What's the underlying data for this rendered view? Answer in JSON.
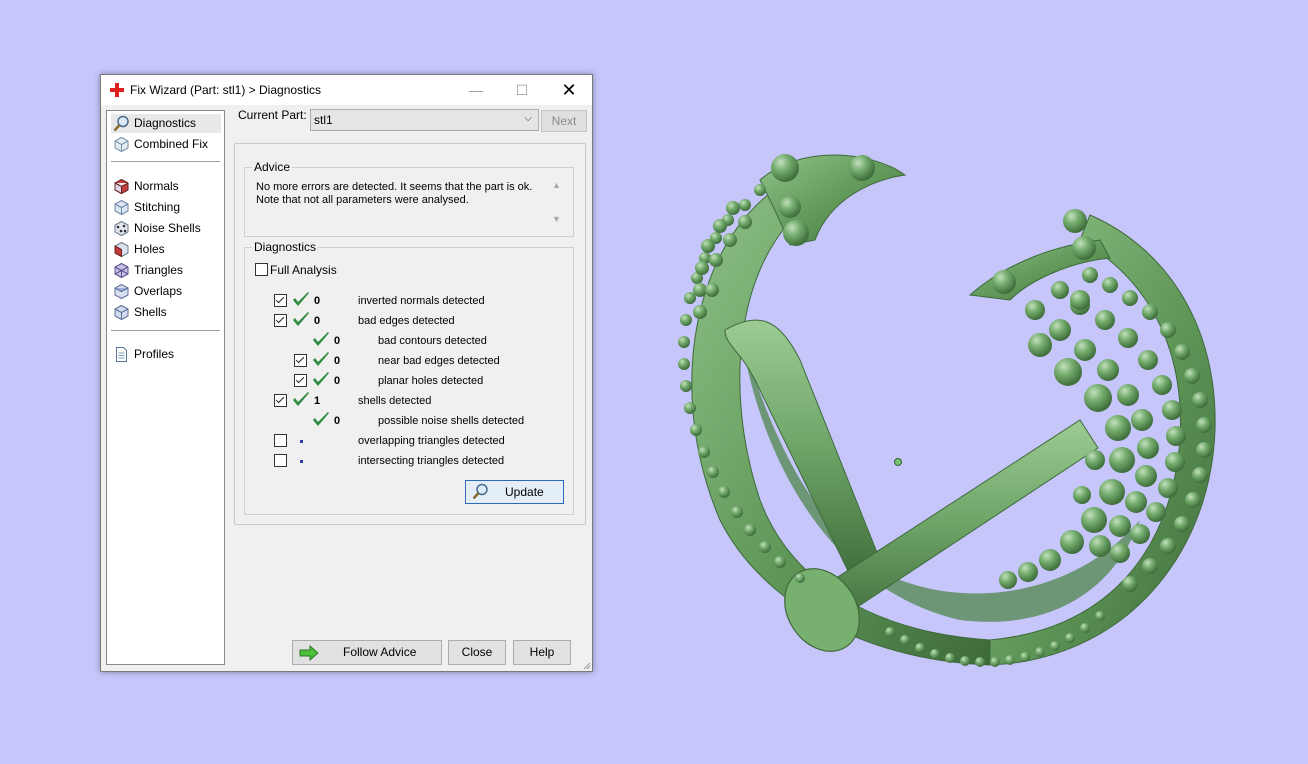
{
  "window": {
    "title": "Fix Wizard (Part: stl1) > Diagnostics",
    "minimize": "—",
    "maximize": "☐",
    "close": "✕"
  },
  "sidebar": {
    "items": [
      {
        "label": "Diagnostics",
        "icon": "magnifier-icon"
      },
      {
        "label": "Combined Fix",
        "icon": "cube-icon"
      },
      {
        "label": "Normals",
        "icon": "normals-cube-icon"
      },
      {
        "label": "Stitching",
        "icon": "stitching-cube-icon"
      },
      {
        "label": "Noise Shells",
        "icon": "noise-shells-icon"
      },
      {
        "label": "Holes",
        "icon": "holes-cube-icon"
      },
      {
        "label": "Triangles",
        "icon": "triangles-icon"
      },
      {
        "label": "Overlaps",
        "icon": "overlaps-cube-icon"
      },
      {
        "label": "Shells",
        "icon": "shells-cube-icon"
      },
      {
        "label": "Profiles",
        "icon": "document-icon"
      }
    ]
  },
  "current_part": {
    "label": "Current Part:",
    "value": "stl1",
    "next_label": "Next"
  },
  "advice": {
    "legend": "Advice",
    "line1": "No more errors are detected. It seems that the part is ok.",
    "line2": "Note that not all parameters were analysed."
  },
  "diagnostics": {
    "legend": "Diagnostics",
    "full_analysis_label": "Full Analysis",
    "full_analysis_checked": false,
    "rows": [
      {
        "checkbox": true,
        "checked": true,
        "status": "ok",
        "count": "0",
        "label": "inverted normals detected",
        "indent": 0
      },
      {
        "checkbox": true,
        "checked": true,
        "status": "ok",
        "count": "0",
        "label": "bad edges detected",
        "indent": 0
      },
      {
        "checkbox": false,
        "checked": false,
        "status": "ok",
        "count": "0",
        "label": "bad contours detected",
        "indent": 1
      },
      {
        "checkbox": true,
        "checked": true,
        "status": "ok",
        "count": "0",
        "label": "near bad edges detected",
        "indent": 1
      },
      {
        "checkbox": true,
        "checked": true,
        "status": "ok",
        "count": "0",
        "label": "planar holes detected",
        "indent": 1
      },
      {
        "checkbox": true,
        "checked": true,
        "status": "ok",
        "count": "1",
        "label": "shells detected",
        "indent": 0
      },
      {
        "checkbox": false,
        "checked": false,
        "status": "ok",
        "count": "0",
        "label": "possible noise shells detected",
        "indent": 1
      },
      {
        "checkbox": true,
        "checked": false,
        "status": "none",
        "count": "",
        "label": "overlapping triangles detected",
        "indent": 0
      },
      {
        "checkbox": true,
        "checked": false,
        "status": "none",
        "count": "",
        "label": "intersecting triangles detected",
        "indent": 0
      }
    ],
    "update_label": "Update"
  },
  "footer": {
    "follow_advice_label": "Follow Advice",
    "close_label": "Close",
    "help_label": "Help"
  },
  "colors": {
    "viewport_background": "#c6c6fb",
    "model_green": "#6fa86a",
    "check_green": "#2e8b3e",
    "title_icon_red": "#e02020"
  }
}
